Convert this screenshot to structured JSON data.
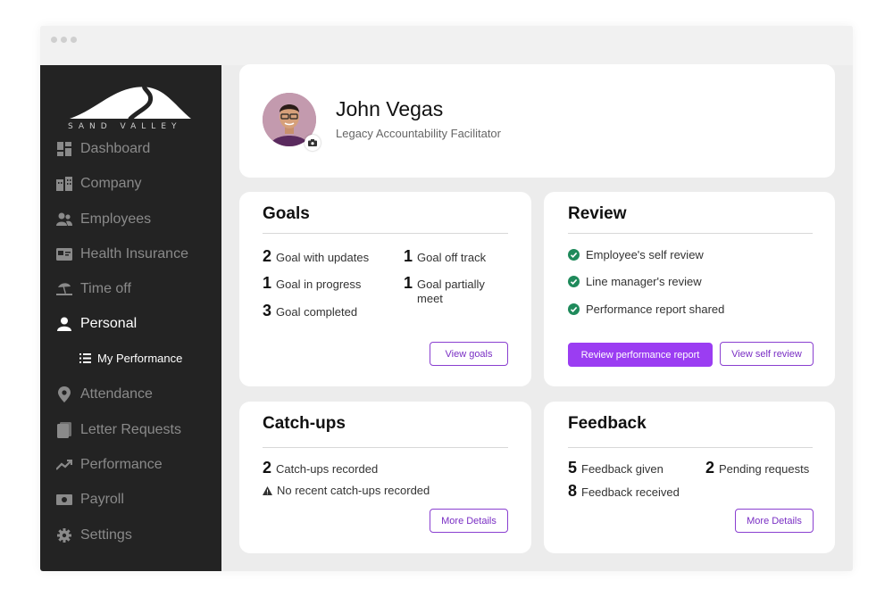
{
  "brand": {
    "logo_text": "SAND VALLEY"
  },
  "sidebar": {
    "items": [
      {
        "label": "Dashboard",
        "icon": "dashboard-icon"
      },
      {
        "label": "Company",
        "icon": "buildings-icon"
      },
      {
        "label": "Employees",
        "icon": "people-icon"
      },
      {
        "label": "Health Insurance",
        "icon": "card-icon"
      },
      {
        "label": "Time off",
        "icon": "beach-icon"
      },
      {
        "label": "Personal",
        "icon": "user-icon",
        "active": true
      },
      {
        "label": "Attendance",
        "icon": "pin-icon"
      },
      {
        "label": "Letter Requests",
        "icon": "document-icon"
      },
      {
        "label": "Performance",
        "icon": "trend-icon"
      },
      {
        "label": "Payroll",
        "icon": "money-icon"
      },
      {
        "label": "Settings",
        "icon": "gear-icon"
      }
    ],
    "sub_item": {
      "label": "My Performance",
      "icon": "list-icon"
    }
  },
  "profile": {
    "name": "John Vegas",
    "title": "Legacy Accountability Facilitator"
  },
  "goals": {
    "title": "Goals",
    "stats": [
      {
        "num": "2",
        "label": "Goal with updates"
      },
      {
        "num": "1",
        "label": "Goal in progress"
      },
      {
        "num": "3",
        "label": "Goal completed"
      },
      {
        "num": "1",
        "label": "Goal off track"
      },
      {
        "num": "1",
        "label": "Goal partially meet"
      }
    ],
    "button": "View goals"
  },
  "review": {
    "title": "Review",
    "items": [
      "Employee's self review",
      "Line manager's review",
      "Performance report shared"
    ],
    "primary_button": "Review performance report",
    "secondary_button": "View self review"
  },
  "catchups": {
    "title": "Catch-ups",
    "recorded_num": "2",
    "recorded_label": "Catch-ups recorded",
    "warning": "No recent catch-ups recorded",
    "button": "More Details"
  },
  "feedback": {
    "title": "Feedback",
    "stats": [
      {
        "num": "5",
        "label": "Feedback given"
      },
      {
        "num": "8",
        "label": "Feedback received"
      },
      {
        "num": "2",
        "label": "Pending requests"
      }
    ],
    "button": "More Details"
  },
  "colors": {
    "accent": "#9b3df2",
    "sidebar_bg": "#232323",
    "check_green": "#1f8a5b"
  }
}
